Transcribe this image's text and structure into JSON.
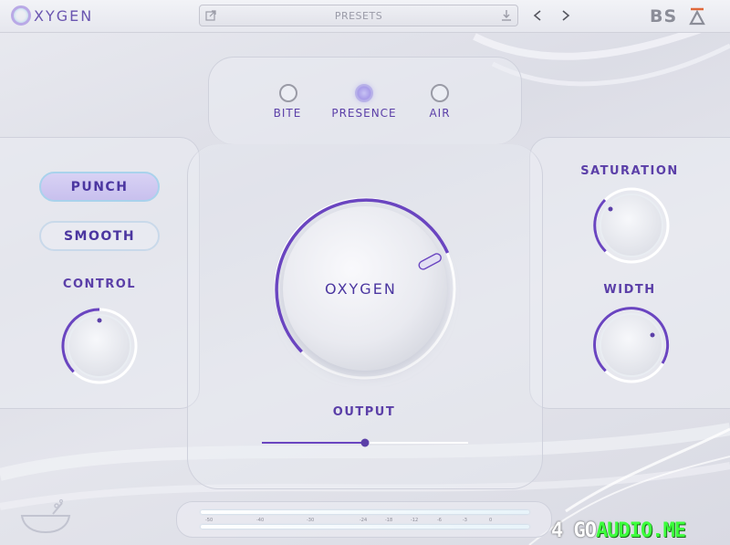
{
  "app": {
    "logo_text": "XYGEN",
    "brand": "BS"
  },
  "presets": {
    "label": "PRESETS"
  },
  "modes": [
    {
      "label": "BITE",
      "active": false
    },
    {
      "label": "PRESENCE",
      "active": true
    },
    {
      "label": "AIR",
      "active": false
    }
  ],
  "left_panel": {
    "punch_label": "PUNCH",
    "smooth_label": "SMOOTH",
    "control_label": "CONTROL"
  },
  "center": {
    "main_knob_label": "OXYGEN",
    "output_label": "OUTPUT",
    "output_level": 0.5
  },
  "right_panel": {
    "saturation_label": "SATURATION",
    "width_label": "WIDTH"
  },
  "meter": {
    "ticks": [
      "-50",
      "-40",
      "-30",
      "-24",
      "-18",
      "-12",
      "-6",
      "-3",
      "0"
    ]
  },
  "watermark": {
    "part1": "4 GO",
    "part2": "AUDIO.ME"
  },
  "colors": {
    "accent": "#6a45c0",
    "label": "#5b3fa8",
    "track": "#ffffff"
  }
}
